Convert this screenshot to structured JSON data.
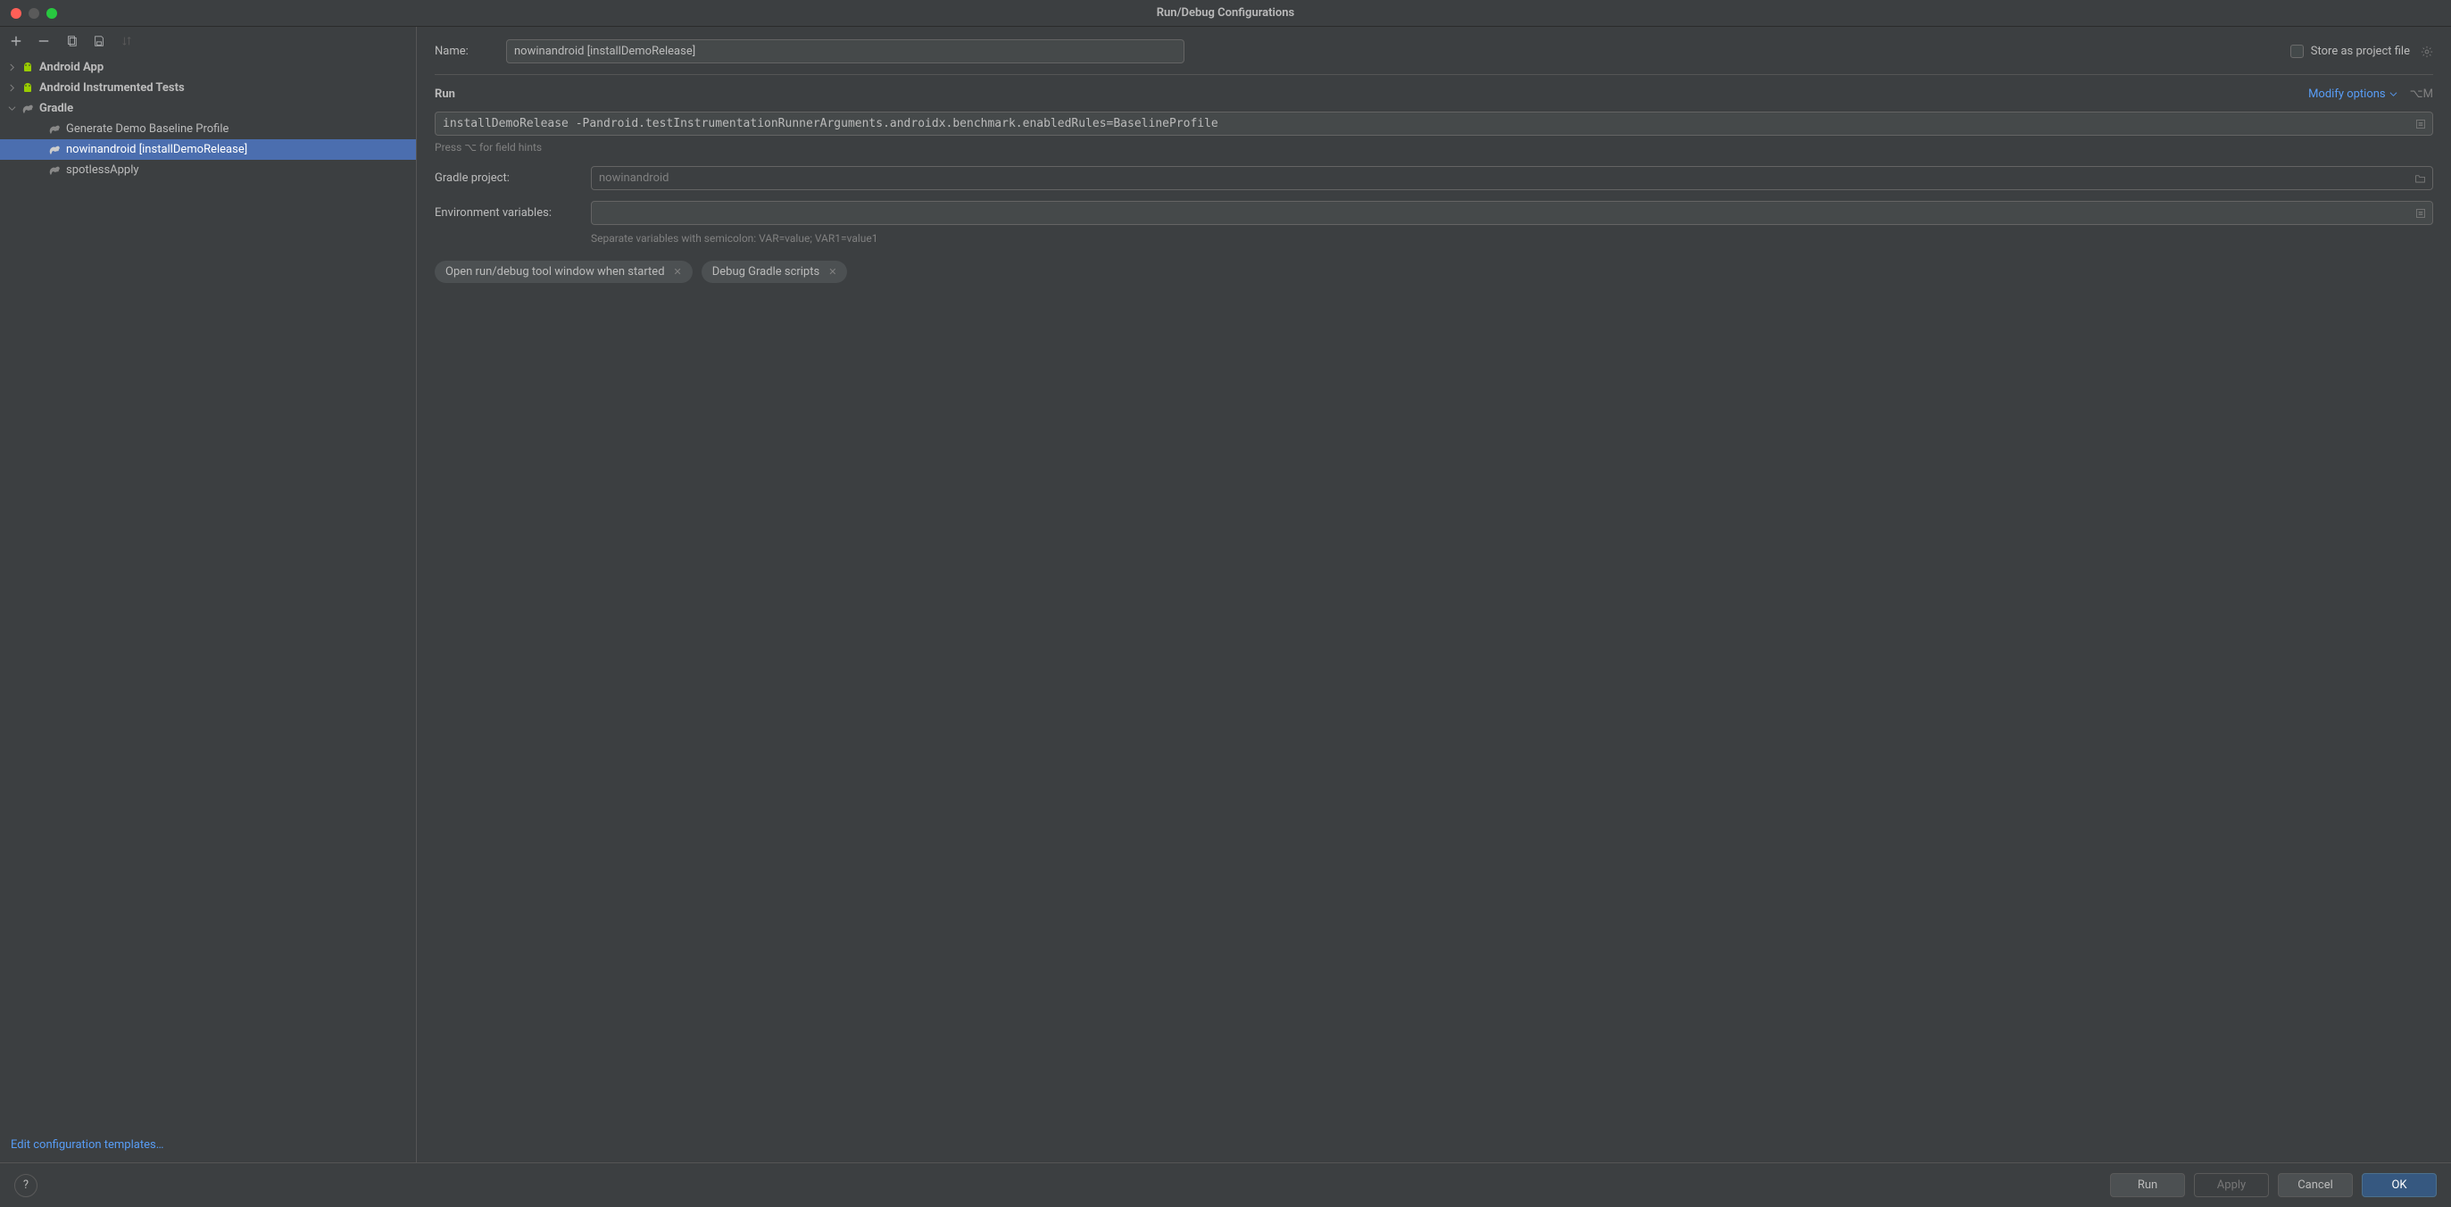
{
  "window": {
    "title": "Run/Debug Configurations"
  },
  "sidebar": {
    "groups": [
      {
        "label": "Android App",
        "expanded": false,
        "icon": "android"
      },
      {
        "label": "Android Instrumented Tests",
        "expanded": false,
        "icon": "android"
      },
      {
        "label": "Gradle",
        "expanded": true,
        "icon": "gradle",
        "children": [
          {
            "label": "Generate Demo Baseline Profile",
            "selected": false
          },
          {
            "label": "nowinandroid [installDemoRelease]",
            "selected": true
          },
          {
            "label": "spotlessApply",
            "selected": false
          }
        ]
      }
    ],
    "edit_templates": "Edit configuration templates…"
  },
  "form": {
    "name_label": "Name:",
    "name_value": "nowinandroid [installDemoRelease]",
    "store_as_project_file": "Store as project file",
    "run_section": "Run",
    "modify_options": "Modify options",
    "modify_shortcut": "⌥M",
    "tasks_value": "installDemoRelease -Pandroid.testInstrumentationRunnerArguments.androidx.benchmark.enabledRules=BaselineProfile",
    "field_hints": "Press ⌥ for field hints",
    "gradle_project_label": "Gradle project:",
    "gradle_project_value": "nowinandroid",
    "env_label": "Environment variables:",
    "env_value": "",
    "env_hint": "Separate variables with semicolon: VAR=value; VAR1=value1",
    "chips": [
      "Open run/debug tool window when started",
      "Debug Gradle scripts"
    ]
  },
  "buttons": {
    "run": "Run",
    "apply": "Apply",
    "cancel": "Cancel",
    "ok": "OK"
  }
}
